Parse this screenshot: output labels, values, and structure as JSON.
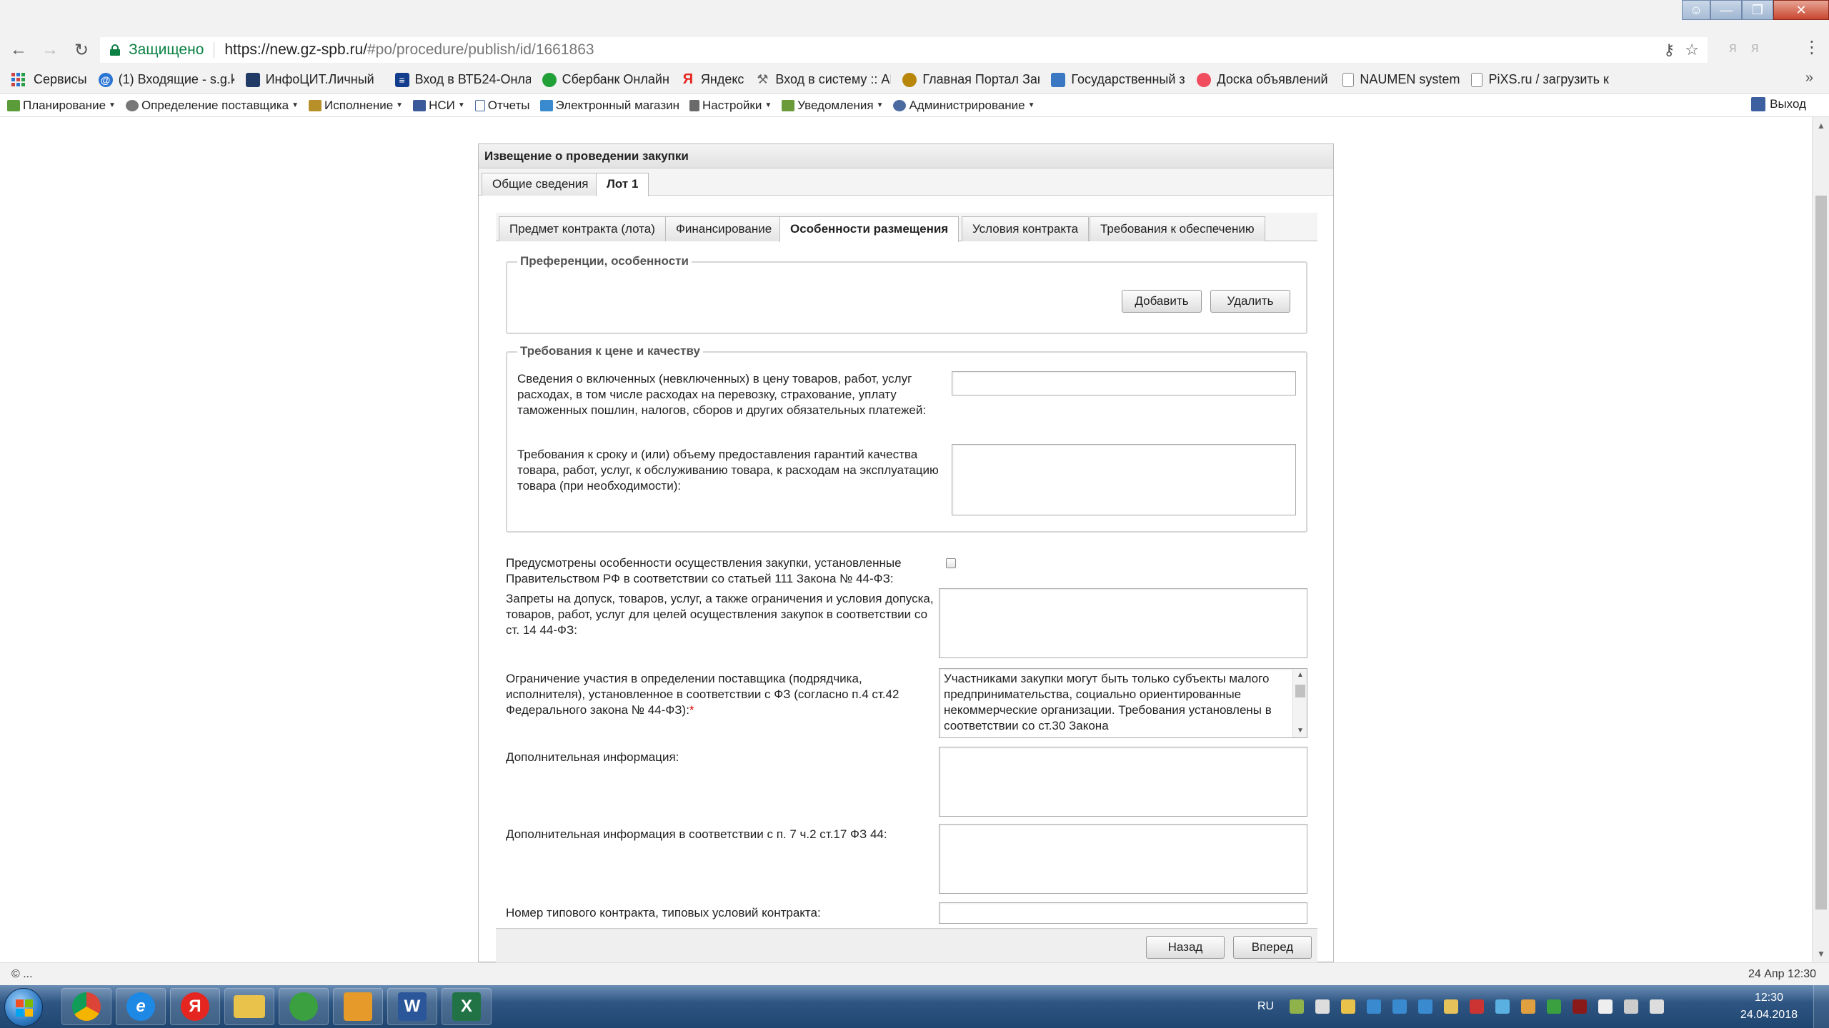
{
  "browser": {
    "secure_label": "Защищено",
    "url_host": "https://new.gz-spb.ru/",
    "url_path": "#po/procedure/publish/id/1661863",
    "bookmarks": [
      {
        "label": "Сервисы",
        "icon": "apps-icon",
        "color": "#4285f4"
      },
      {
        "label": "(1) Входящие - s.g.k",
        "icon": "mail-icon",
        "color": "#2a74d4"
      },
      {
        "label": "ИнфоЦИТ.Личный",
        "icon": "infocit-icon",
        "color": "#1f3b66"
      },
      {
        "label": "Вход в ВТБ24-Онла",
        "icon": "vtb-icon",
        "color": "#123c8c"
      },
      {
        "label": "Сбербанк Онлайн",
        "icon": "sberbank-icon",
        "color": "#21a038"
      },
      {
        "label": "Яндекс",
        "icon": "yandex-icon",
        "color": "#e52620"
      },
      {
        "label": "Вход в систему :: АИ",
        "icon": "tools-icon",
        "color": "#666666"
      },
      {
        "label": "Главная Портал Зак",
        "icon": "emblem-icon",
        "color": "#b8860b"
      },
      {
        "label": "Государственный з",
        "icon": "gov-icon",
        "color": "#3a78c3"
      },
      {
        "label": "Доска объявлений",
        "icon": "board-icon",
        "color": "#f04e5e"
      },
      {
        "label": "NAUMEN system",
        "icon": "page-icon",
        "color": "#ffffff"
      },
      {
        "label": "PiXS.ru / загрузить к",
        "icon": "page-icon",
        "color": "#ffffff"
      }
    ],
    "status_left": "© ...",
    "status_right": "24 Апр 12:30"
  },
  "appmenu": {
    "items": [
      {
        "label": "Планирование",
        "color": "#5a9b3a",
        "has_caret": true
      },
      {
        "label": "Определение поставщика",
        "color": "#777777",
        "has_caret": true
      },
      {
        "label": "Исполнение",
        "color": "#b8902a",
        "has_caret": true
      },
      {
        "label": "НСИ",
        "color": "#3a5a9a",
        "has_caret": true
      },
      {
        "label": "Отчеты",
        "color": "#4a6aa0",
        "has_caret": false
      },
      {
        "label": "Электронный магазин",
        "color": "#3a8ad0",
        "has_caret": false
      },
      {
        "label": "Настройки",
        "color": "#6a6a6a",
        "has_caret": true
      },
      {
        "label": "Уведомления",
        "color": "#6a9a3a",
        "has_caret": true
      },
      {
        "label": "Администрирование",
        "color": "#4a6aa0",
        "has_caret": true
      }
    ],
    "logout": "Выход"
  },
  "dialog": {
    "title": "Извещение о проведении закупки",
    "outer_tabs": [
      {
        "label": "Общие сведения",
        "active": false
      },
      {
        "label": "Лот 1",
        "active": true
      }
    ],
    "inner_tabs": [
      {
        "label": "Предмет контракта (лота)",
        "active": false
      },
      {
        "label": "Финансирование",
        "active": false
      },
      {
        "label": "Особенности размещения",
        "active": true
      },
      {
        "label": "Условия контракта",
        "active": false
      },
      {
        "label": "Требования к обеспечению",
        "active": false
      }
    ],
    "preferences": {
      "legend": "Преференции, особенности",
      "add_button": "Добавить",
      "delete_button": "Удалить"
    },
    "price_quality": {
      "legend": "Требования к цене и качеству",
      "included_label": "Сведения о включенных (невключенных) в цену товаров, работ, услуг расходах, в том числе расходах на перевозку, страхование, уплату таможенных пошлин, налогов, сборов и других обязательных платежей:",
      "included_value": "",
      "guarantee_label": "Требования к сроку и (или) объему предоставления гарантий качества товара, работ, услуг, к обслуживанию товара, к расходам на эксплуатацию товара (при необходимости):",
      "guarantee_value": ""
    },
    "features_label": "Предусмотрены особенности осуществления закупки, установленные Правительством РФ в соответствии со статьей 111 Закона № 44-ФЗ:",
    "features_checked": false,
    "bans_label": "Запреты на допуск, товаров, услуг, а также ограничения и условия допуска, товаров, работ, услуг для целей осуществления закупок в соответствии со ст. 14 44-ФЗ:",
    "bans_value": "",
    "limit_label": "Ограничение участия в определении поставщика (подрядчика, исполнителя), установленное в соответствии с ФЗ (согласно п.4 ст.42 Федерального закона № 44-ФЗ):",
    "limit_required": "*",
    "limit_value": "Участниками закупки могут быть только субъекты малого предпринимательства, социально ориентированные некоммерческие организации. Требования установлены в соответствии со ст.30 Закона",
    "extra_label": "Дополнительная информация:",
    "extra_value": "",
    "extra17_label": "Дополнительная информация в соответствии с п. 7 ч.2 ст.17 ФЗ 44:",
    "extra17_value": "",
    "typical_label": "Номер типового контракта, типовых условий контракта:",
    "typical_value": "",
    "back_button": "Назад",
    "forward_button": "Вперед"
  },
  "taskbar": {
    "apps": [
      {
        "name": "chrome",
        "color": "#db4437"
      },
      {
        "name": "internet-explorer",
        "color": "#1e88e5"
      },
      {
        "name": "yandex-browser",
        "color": "#e52620"
      },
      {
        "name": "file-explorer",
        "color": "#e8c24a"
      },
      {
        "name": "qip",
        "color": "#3aa040"
      },
      {
        "name": "outlook",
        "color": "#e69a2a"
      },
      {
        "name": "word",
        "color": "#2b579a"
      },
      {
        "name": "excel",
        "color": "#217346"
      }
    ],
    "word_glyph": "W",
    "excel_glyph": "X",
    "yandex_glyph": "Я",
    "lang": "RU",
    "time": "12:30",
    "date": "24.04.2018"
  }
}
